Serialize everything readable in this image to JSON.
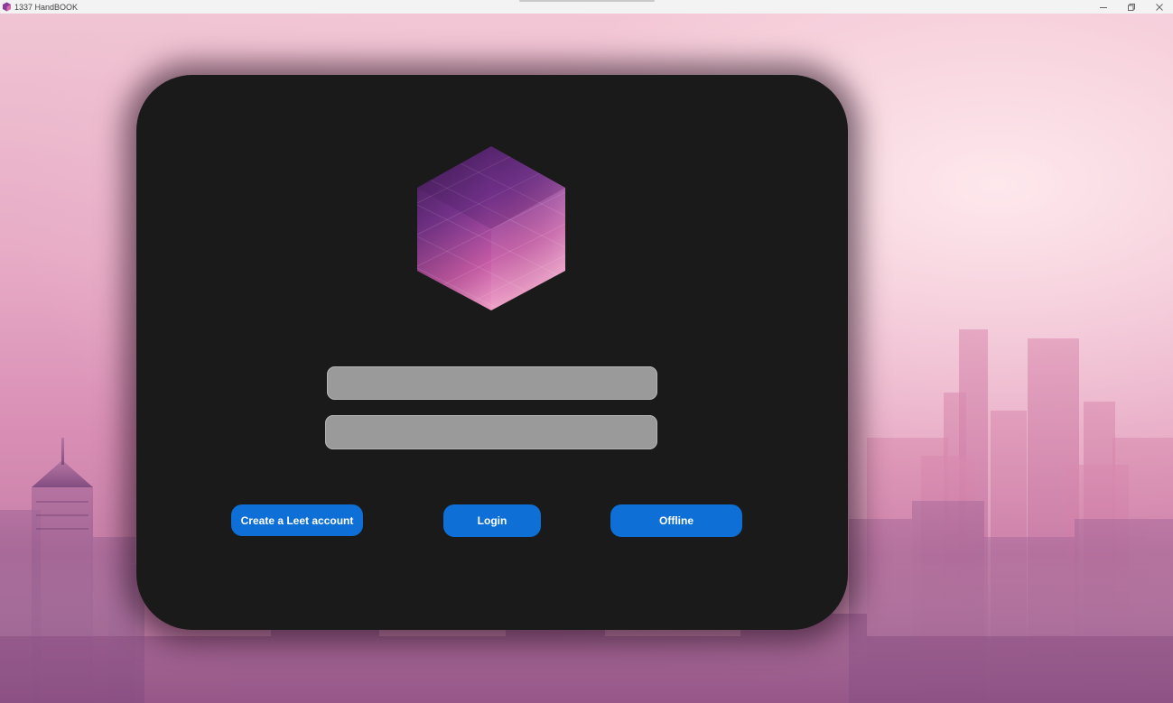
{
  "window": {
    "title": "1337 HandBOOK",
    "controls": [
      "minimize-icon",
      "restore-icon",
      "close-icon"
    ]
  },
  "login_card": {
    "logo": "hexagon-cube-logo",
    "username": {
      "value": "",
      "placeholder": ""
    },
    "password": {
      "value": "",
      "placeholder": ""
    },
    "buttons": {
      "create_account": "Create a Leet account",
      "login": "Login",
      "offline": "Offline"
    }
  },
  "colors": {
    "accent": "#0e6fd6",
    "card": "#1a1a1a",
    "field": "#9a9a9a",
    "logo_dark": "#5a2a6e",
    "logo_light": "#f2a2c8"
  }
}
